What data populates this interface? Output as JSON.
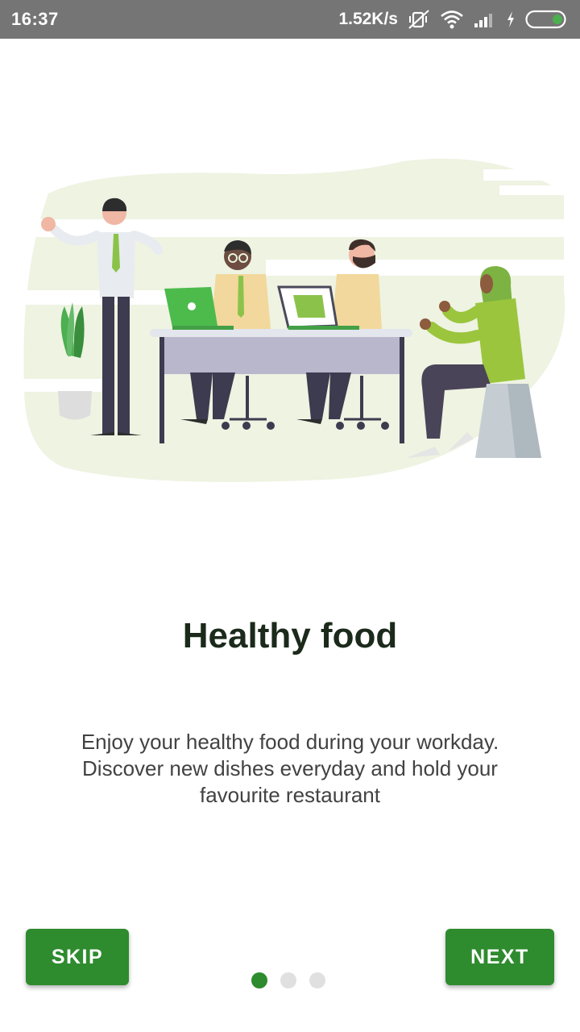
{
  "status_bar": {
    "time": "16:37",
    "network_speed": "1.52K/s",
    "icons": [
      "mute-vibrate-icon",
      "wifi-icon",
      "signal-icon",
      "charging-icon",
      "battery-icon"
    ]
  },
  "onboarding": {
    "illustration": "office-team-illustration",
    "title": "Healthy food",
    "description": "Enjoy your healthy food during your workday. Discover new dishes everyday and hold your favourite restaurant",
    "skip_label": "SKIP",
    "next_label": "NEXT",
    "page_count": 3,
    "current_page": 1
  },
  "colors": {
    "accent": "#2e8b2e",
    "status_bar": "#757575",
    "dot_inactive": "#e0e0e0",
    "illustration_bg": "#eef3e2"
  }
}
